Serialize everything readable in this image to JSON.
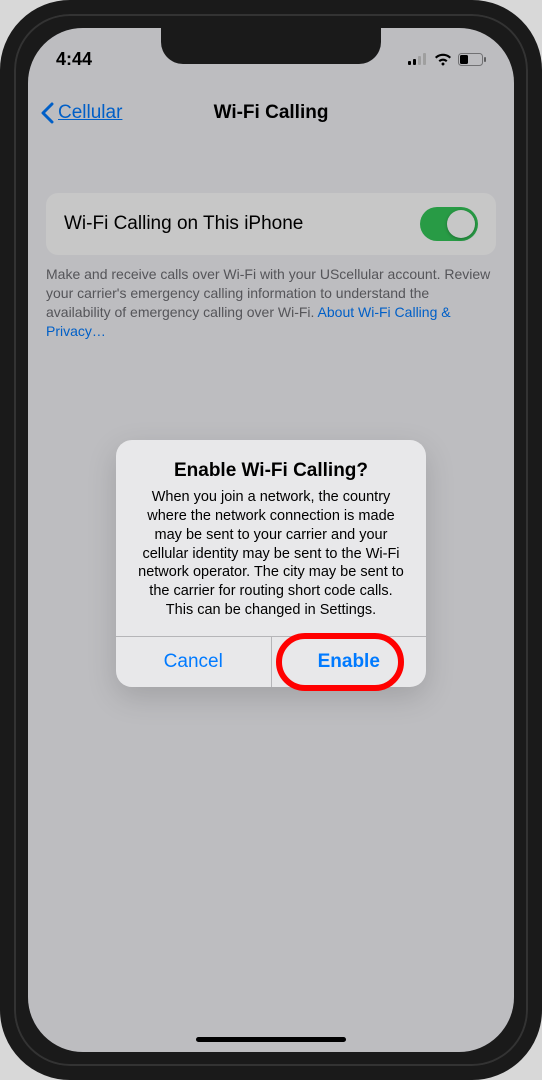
{
  "status_bar": {
    "time": "4:44"
  },
  "nav": {
    "back_label": "Cellular",
    "title": "Wi-Fi Calling"
  },
  "setting": {
    "label": "Wi-Fi Calling on This iPhone",
    "toggle_on": true
  },
  "footer": {
    "text": "Make and receive calls over Wi-Fi with your UScellular account. Review your carrier's emergency calling information to understand the availability of emergency calling over Wi-Fi. ",
    "link_text": "About Wi-Fi Calling & Privacy…"
  },
  "alert": {
    "title": "Enable Wi-Fi Calling?",
    "message": "When you join a network, the country where the network connection is made may be sent to your carrier and your cellular identity may be sent to the Wi-Fi network operator. The city may be sent to the carrier for routing short code calls. This can be changed in Settings.",
    "cancel_label": "Cancel",
    "confirm_label": "Enable"
  },
  "annotation": {
    "highlighted_button": "enable"
  }
}
